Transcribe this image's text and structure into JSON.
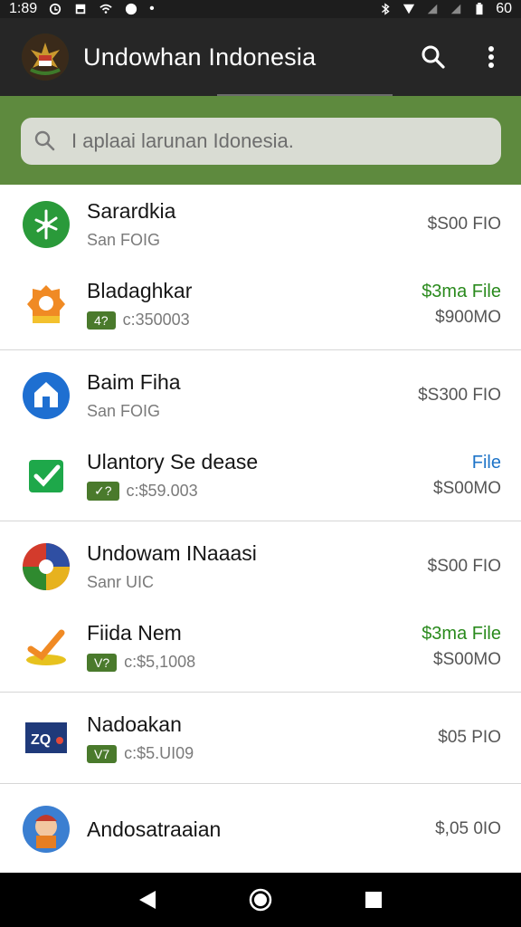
{
  "status_bar": {
    "time": "1:89",
    "battery": "60"
  },
  "app_bar": {
    "title": "Undowhan Indonesia"
  },
  "search": {
    "placeholder": "I aplaai larunan Idonesia."
  },
  "groups": [
    {
      "items": [
        {
          "title": "Sarardkia",
          "sub": "San FOIG",
          "tag": "",
          "right_top": "$S00 FIO",
          "right_top_color": "",
          "right_bottom": "",
          "icon": "green-plant-icon"
        },
        {
          "title": "Bladaghkar",
          "sub": "c:350003",
          "tag": "4?",
          "right_top": "$3ma File",
          "right_top_color": "green",
          "right_bottom": "$900MO",
          "icon": "orange-badge-icon"
        }
      ]
    },
    {
      "items": [
        {
          "title": "Baim Fiha",
          "sub": "San FOIG",
          "tag": "",
          "right_top": "$S300 FIO",
          "right_top_color": "",
          "right_bottom": "",
          "icon": "blue-home-icon"
        },
        {
          "title": "Ulantory Se dease",
          "sub": "c:$59.003",
          "tag": "✓?",
          "right_top": "File",
          "right_top_color": "blue",
          "right_bottom": "$S00MO",
          "icon": "green-check-icon"
        }
      ]
    },
    {
      "items": [
        {
          "title": "Undowam INaaasi",
          "sub": "Sanr UIC",
          "tag": "",
          "right_top": "$S00 FIO",
          "right_top_color": "",
          "right_bottom": "",
          "icon": "colorful-pie-icon"
        },
        {
          "title": "Fiida Nem",
          "sub": "c:$5,1008",
          "tag": "V?",
          "right_top": "$3ma File",
          "right_top_color": "green",
          "right_bottom": "$S00MO",
          "icon": "yellow-check-icon"
        }
      ]
    },
    {
      "items": [
        {
          "title": "Nadoakan",
          "sub": "c:$5.UI09",
          "tag": "V7",
          "right_top": "$05 PIO",
          "right_top_color": "",
          "right_bottom": "",
          "icon": "zq-logo-icon"
        }
      ]
    },
    {
      "items": [
        {
          "title": "Andosatraaian",
          "sub": "",
          "tag": "",
          "right_top": "$,05 0IO",
          "right_top_color": "",
          "right_bottom": "",
          "icon": "character-avatar-icon"
        }
      ]
    }
  ],
  "colors": {
    "appbar": "#262626",
    "search_band": "#5e8a3e",
    "green_accent": "#2a8a1d",
    "blue_accent": "#1e74c8"
  }
}
